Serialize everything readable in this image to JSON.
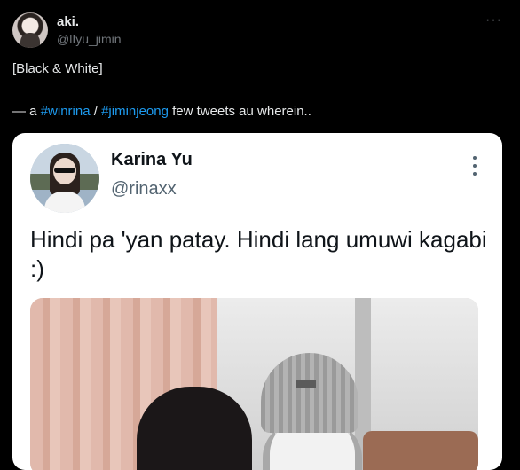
{
  "tweet": {
    "author_name": "aki.",
    "author_handle": "@lIyu_jimin",
    "more_label": "···",
    "line1": "[Black & White]",
    "line2_prefix": "— a ",
    "hashtag1": "#winrina",
    "separator": " / ",
    "hashtag2": "#jiminjeong",
    "line2_suffix": " few tweets au wherein.."
  },
  "quoted_card": {
    "author_name": "Karina Yu",
    "author_handle": "@rinaxx",
    "text": "Hindi pa 'yan patay. Hindi lang umuwi kagabi :)"
  },
  "icons": {
    "more": "more-horizontal-icon",
    "card_more": "more-vertical-icon"
  },
  "colors": {
    "background": "#000000",
    "hashtag": "#1d9bf0",
    "card_background": "#ffffff"
  }
}
